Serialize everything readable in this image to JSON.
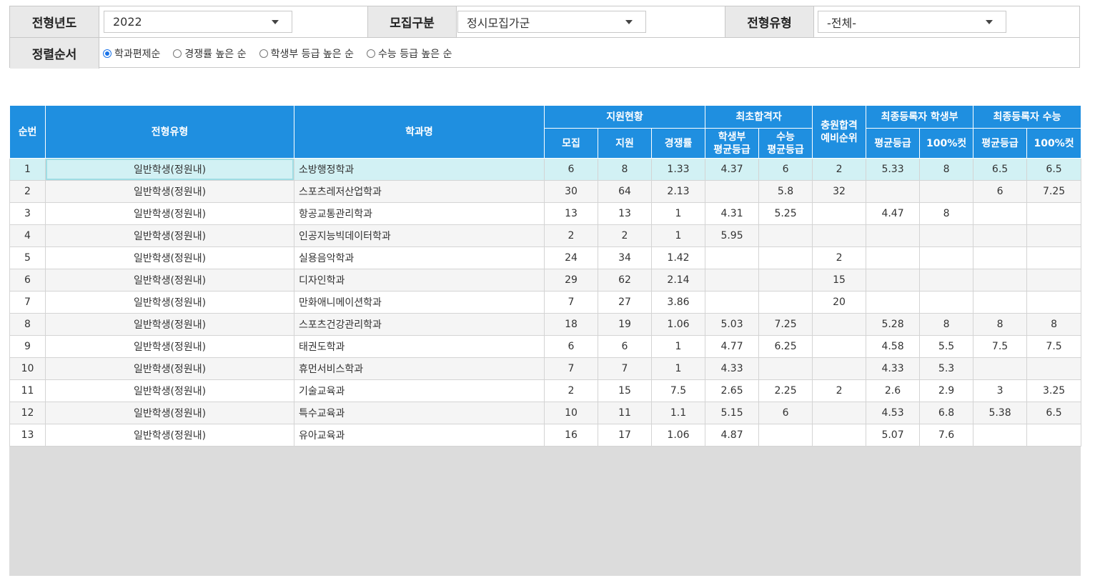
{
  "filters": {
    "year_label": "전형년도",
    "year_value": "2022",
    "recruit_label": "모집구분",
    "recruit_value": "정시모집가군",
    "type_label": "전형유형",
    "type_value": "-전체-",
    "sort_label": "정렬순서",
    "sort_options": [
      "학과편제순",
      "경쟁률 높은 순",
      "학생부 등급 높은 순",
      "수능 등급 높은 순"
    ],
    "sort_selected": "학과편제순"
  },
  "table": {
    "headers": {
      "no": "순번",
      "type": "전형유형",
      "dept": "학과명",
      "apply_group": "지원현황",
      "recruit": "모집",
      "apply": "지원",
      "ratio": "경쟁률",
      "first_group": "최초합격자",
      "first_school": "학생부\n평균등급",
      "first_csat": "수능\n평균등급",
      "waitlist": "충원합격\n예비순위",
      "final_school_group": "최종등록자 학생부",
      "final_csat_group": "최종등록자 수능",
      "avg": "평균등급",
      "cut": "100%컷"
    },
    "selected_row": 0,
    "rows": [
      [
        "1",
        "일반학생(정원내)",
        "소방행정학과",
        "6",
        "8",
        "1.33",
        "4.37",
        "6",
        "2",
        "5.33",
        "8",
        "6.5",
        "6.5"
      ],
      [
        "2",
        "일반학생(정원내)",
        "스포츠레저산업학과",
        "30",
        "64",
        "2.13",
        "",
        "5.8",
        "32",
        "",
        "",
        "6",
        "7.25"
      ],
      [
        "3",
        "일반학생(정원내)",
        "항공교통관리학과",
        "13",
        "13",
        "1",
        "4.31",
        "5.25",
        "",
        "4.47",
        "8",
        "",
        ""
      ],
      [
        "4",
        "일반학생(정원내)",
        "인공지능빅데이터학과",
        "2",
        "2",
        "1",
        "5.95",
        "",
        "",
        "",
        "",
        "",
        ""
      ],
      [
        "5",
        "일반학생(정원내)",
        "실용음악학과",
        "24",
        "34",
        "1.42",
        "",
        "",
        "2",
        "",
        "",
        "",
        ""
      ],
      [
        "6",
        "일반학생(정원내)",
        "디자인학과",
        "29",
        "62",
        "2.14",
        "",
        "",
        "15",
        "",
        "",
        "",
        ""
      ],
      [
        "7",
        "일반학생(정원내)",
        "만화애니메이션학과",
        "7",
        "27",
        "3.86",
        "",
        "",
        "20",
        "",
        "",
        "",
        ""
      ],
      [
        "8",
        "일반학생(정원내)",
        "스포츠건강관리학과",
        "18",
        "19",
        "1.06",
        "5.03",
        "7.25",
        "",
        "5.28",
        "8",
        "8",
        "8"
      ],
      [
        "9",
        "일반학생(정원내)",
        "태권도학과",
        "6",
        "6",
        "1",
        "4.77",
        "6.25",
        "",
        "4.58",
        "5.5",
        "7.5",
        "7.5"
      ],
      [
        "10",
        "일반학생(정원내)",
        "휴먼서비스학과",
        "7",
        "7",
        "1",
        "4.33",
        "",
        "",
        "4.33",
        "5.3",
        "",
        ""
      ],
      [
        "11",
        "일반학생(정원내)",
        "기술교육과",
        "2",
        "15",
        "7.5",
        "2.65",
        "2.25",
        "2",
        "2.6",
        "2.9",
        "3",
        "3.25"
      ],
      [
        "12",
        "일반학생(정원내)",
        "특수교육과",
        "10",
        "11",
        "1.1",
        "5.15",
        "6",
        "",
        "4.53",
        "6.8",
        "5.38",
        "6.5"
      ],
      [
        "13",
        "일반학생(정원내)",
        "유아교육과",
        "16",
        "17",
        "1.06",
        "4.87",
        "",
        "",
        "5.07",
        "7.6",
        "",
        ""
      ]
    ]
  }
}
